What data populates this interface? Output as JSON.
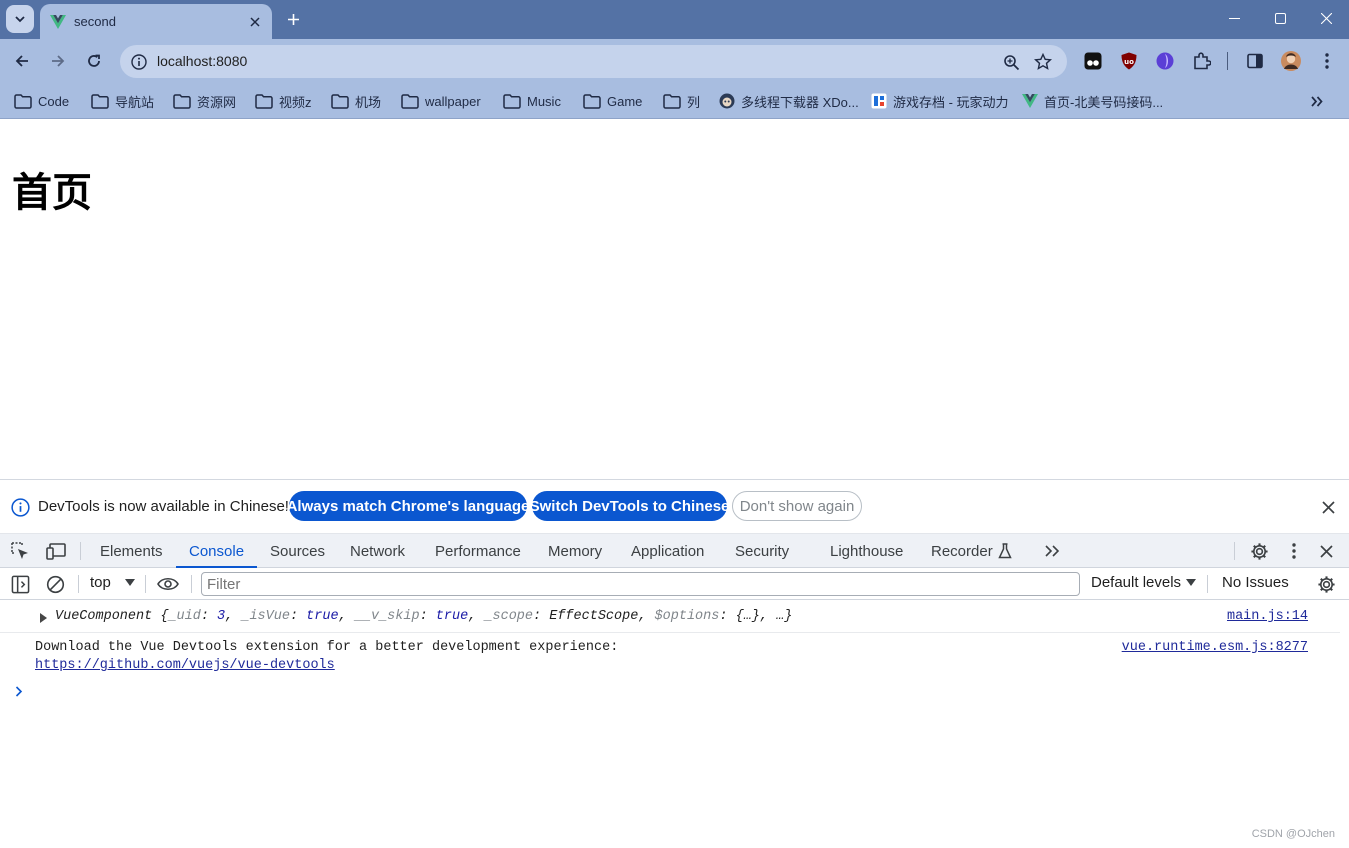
{
  "browser": {
    "tab": {
      "title": "second"
    },
    "url": "localhost:8080",
    "bookmarks": [
      {
        "label": "Code",
        "icon": "folder-icon"
      },
      {
        "label": "导航站",
        "icon": "folder-icon"
      },
      {
        "label": "资源网",
        "icon": "folder-icon"
      },
      {
        "label": "视频z",
        "icon": "folder-icon"
      },
      {
        "label": "机场",
        "icon": "folder-icon"
      },
      {
        "label": "wallpaper",
        "icon": "folder-icon"
      },
      {
        "label": "Music",
        "icon": "folder-icon"
      },
      {
        "label": "Game",
        "icon": "folder-icon"
      },
      {
        "label": "列",
        "icon": "folder-icon"
      },
      {
        "label": "多线程下载器 XDo...",
        "icon": "xdown-favicon"
      },
      {
        "label": "游戏存档 - 玩家动力",
        "icon": "site-favicon"
      },
      {
        "label": "首页-北美号码接码...",
        "icon": "vue-favicon"
      }
    ]
  },
  "page": {
    "heading": "首页"
  },
  "devtools": {
    "infobar": {
      "text": "DevTools is now available in Chinese!",
      "btn_match": "Always match Chrome's language",
      "btn_switch": "Switch DevTools to Chinese",
      "btn_dismiss": "Don't show again"
    },
    "tabs": [
      "Elements",
      "Console",
      "Sources",
      "Network",
      "Performance",
      "Memory",
      "Application",
      "Security",
      "Lighthouse",
      "Recorder"
    ],
    "active_tab": "Console",
    "console": {
      "context": "top",
      "filter_placeholder": "Filter",
      "levels": "Default levels",
      "issues": "No Issues",
      "messages": [
        {
          "obj_name": "VueComponent",
          "obj_preview": {
            "uid_key": "_uid",
            "uid_val": "3",
            "isvue_key": "_isVue",
            "isvue_val": "true",
            "vskip_key": "__v_skip",
            "vskip_val": "true",
            "scope_key": "_scope",
            "scope_val": "EffectScope",
            "options_key": "$options",
            "options_val": "{…}",
            "rest": "…"
          },
          "source": "main.js:14"
        },
        {
          "line1": "Download the Vue Devtools extension for a better development experience:",
          "line2": "https://github.com/vuejs/vue-devtools",
          "source": "vue.runtime.esm.js:8277"
        }
      ]
    }
  },
  "watermark": "CSDN @OJchen",
  "colors": {
    "accent": "#0b57d0",
    "chrome_frame": "#5472a5",
    "chrome_toolbar": "#a8bde0"
  }
}
